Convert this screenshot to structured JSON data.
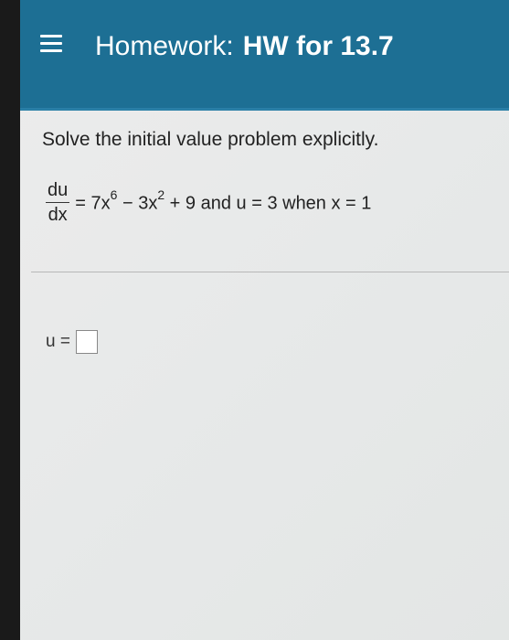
{
  "header": {
    "menu_icon": "hamburger-menu-icon",
    "title_prefix": "Homework:",
    "assignment_name": "HW for 13.7"
  },
  "problem": {
    "instruction": "Solve the initial value problem explicitly.",
    "equation": {
      "numerator": "du",
      "denominator": "dx",
      "rhs_parts": [
        "= 7x",
        "6",
        " − 3x",
        "2",
        " + 9 and u = 3 when x = 1"
      ]
    }
  },
  "answer": {
    "label": "u =",
    "value": ""
  },
  "colors": {
    "header_bg": "#1d6f94",
    "header_text": "#ffffff",
    "page_bg": "#ececec"
  }
}
